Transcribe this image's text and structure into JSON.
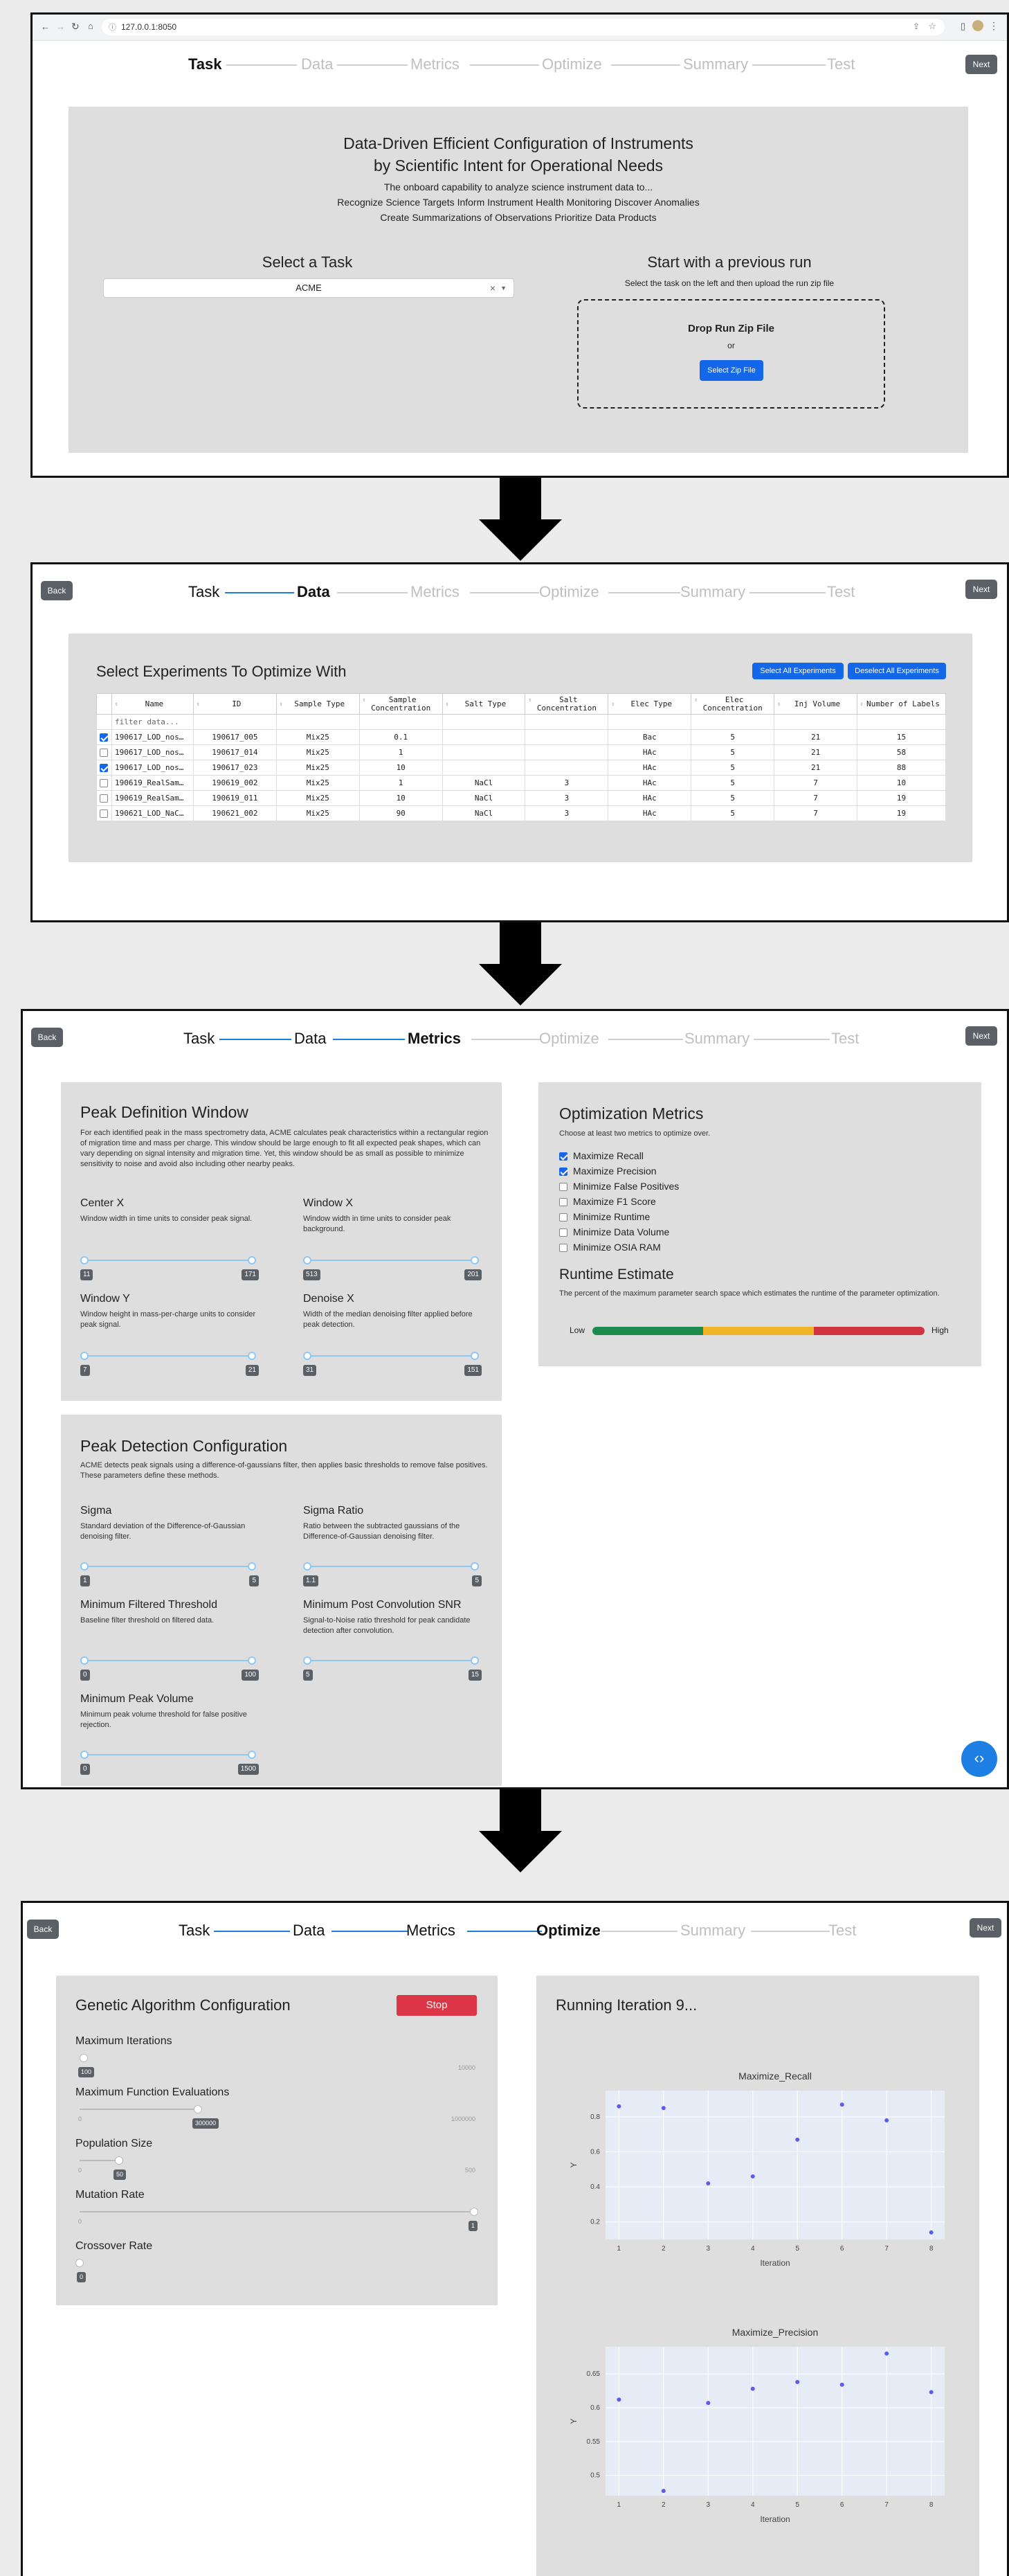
{
  "browser": {
    "url": "127.0.0.1:8050"
  },
  "steps": [
    "Task",
    "Data",
    "Metrics",
    "Optimize",
    "Summary",
    "Test"
  ],
  "buttons": {
    "next": "Next",
    "back": "Back"
  },
  "task_page": {
    "heading_line1": "Data-Driven Efficient Configuration of Instruments",
    "heading_line2": "by Scientific Intent for Operational Needs",
    "sub1": "The onboard capability to analyze science instrument data to...",
    "sub2": "Recognize Science Targets Inform Instrument Health Monitoring Discover Anomalies",
    "sub3": "Create Summarizations of Observations Prioritize Data Products",
    "select_title": "Select a Task",
    "select_value": "ACME",
    "select_clear": "×",
    "prev_title": "Start with a previous run",
    "prev_sub": "Select the task on the left and then upload the run zip file",
    "drop_title": "Drop Run Zip File",
    "drop_or": "or",
    "drop_button": "Select Zip File"
  },
  "data_page": {
    "title": "Select Experiments To Optimize With",
    "select_all": "Select All Experiments",
    "deselect_all": "Deselect All Experiments",
    "filter_placeholder": "filter data...",
    "columns": [
      "Name",
      "ID",
      "Sample Type",
      "Sample Concentration",
      "Salt Type",
      "Salt Concentration",
      "Elec Type",
      "Elec Concentration",
      "Inj Volume",
      "Number of Labels"
    ],
    "rows": [
      {
        "checked": true,
        "cells": [
          "190617_LOD_nos…",
          "190617_005",
          "Mix25",
          "0.1",
          "",
          "",
          "Bac",
          "5",
          "21",
          "15"
        ]
      },
      {
        "checked": false,
        "cells": [
          "190617_LOD_nos…",
          "190617_014",
          "Mix25",
          "1",
          "",
          "",
          "HAc",
          "5",
          "21",
          "58"
        ]
      },
      {
        "checked": true,
        "cells": [
          "190617_LOD_nos…",
          "190617_023",
          "Mix25",
          "10",
          "",
          "",
          "HAc",
          "5",
          "21",
          "88"
        ]
      },
      {
        "checked": false,
        "cells": [
          "190619_RealSam…",
          "190619_002",
          "Mix25",
          "1",
          "NaCl",
          "3",
          "HAc",
          "5",
          "7",
          "10"
        ]
      },
      {
        "checked": false,
        "cells": [
          "190619_RealSam…",
          "190619_011",
          "Mix25",
          "10",
          "NaCl",
          "3",
          "HAc",
          "5",
          "7",
          "19"
        ]
      },
      {
        "checked": false,
        "cells": [
          "190621_LOD_NaC…",
          "190621_002",
          "Mix25",
          "90",
          "NaCl",
          "3",
          "HAc",
          "5",
          "7",
          "19"
        ]
      }
    ]
  },
  "metrics_page": {
    "peak_def": {
      "title": "Peak Definition Window",
      "desc": "For each identified peak in the mass spectrometry data, ACME calculates peak characteristics within a rectangular region of migration time and mass per charge. This window should be large enough to fit all expected peak shapes, which can vary depending on signal intensity and migration time. Yet, this window should be as small as possible to minimize sensitivity to noise and avoid also including other nearby peaks.",
      "params": [
        {
          "name": "Center X",
          "desc": "Window width in time units to consider peak signal.",
          "min": "11",
          "max": "171"
        },
        {
          "name": "Window X",
          "desc": "Window width in time units to consider peak background.",
          "min": "513",
          "max": "201"
        },
        {
          "name": "Window Y",
          "desc": "Window height in mass-per-charge units to consider peak signal.",
          "min": "7",
          "max": "21"
        },
        {
          "name": "Denoise X",
          "desc": "Width of the median denoising filter applied before peak detection.",
          "min": "31",
          "max": "151"
        }
      ]
    },
    "peak_det": {
      "title": "Peak Detection Configuration",
      "desc": "ACME detects peak signals using a difference-of-gaussians filter, then applies basic thresholds to remove false positives. These parameters define these methods.",
      "params": [
        {
          "name": "Sigma",
          "desc": "Standard deviation of the Difference-of-Gaussian denoising filter.",
          "min": "1",
          "max": "5"
        },
        {
          "name": "Sigma Ratio",
          "desc": "Ratio between the subtracted gaussians of the Difference-of-Gaussian denoising filter.",
          "min": "1.1",
          "max": "5"
        },
        {
          "name": "Minimum Filtered Threshold",
          "desc": "Baseline filter threshold on filtered data.",
          "min": "0",
          "max": "100"
        },
        {
          "name": "Minimum Post Convolution SNR",
          "desc": "Signal-to-Noise ratio threshold for peak candidate detection after convolution.",
          "min": "5",
          "max": "15"
        },
        {
          "name": "Minimum Peak Volume",
          "desc": "Minimum peak volume threshold for false positive rejection.",
          "min": "0",
          "max": "1500"
        }
      ]
    },
    "opt_metrics": {
      "title": "Optimization Metrics",
      "desc": "Choose at least two metrics to optimize over.",
      "items": [
        {
          "label": "Maximize Recall",
          "checked": true
        },
        {
          "label": "Maximize Precision",
          "checked": true
        },
        {
          "label": "Minimize False Positives",
          "checked": false
        },
        {
          "label": "Maximize F1 Score",
          "checked": false
        },
        {
          "label": "Minimize Runtime",
          "checked": false
        },
        {
          "label": "Minimize Data Volume",
          "checked": false
        },
        {
          "label": "Minimize OSIA RAM",
          "checked": false
        }
      ],
      "runtime_title": "Runtime Estimate",
      "runtime_desc": "The percent of the maximum parameter search space which estimates the runtime of the parameter optimization.",
      "low": "Low",
      "high": "High"
    },
    "chevrons": "‹›"
  },
  "optimize_page": {
    "ga_title": "Genetic Algorithm Configuration",
    "stop": "Stop",
    "params": [
      {
        "name": "Maximum Iterations",
        "min": "",
        "max": "10000",
        "value": "100",
        "fraction": 0.01
      },
      {
        "name": "Maximum Function Evaluations",
        "min": "0",
        "max": "1000000",
        "value": "300000",
        "fraction": 0.3
      },
      {
        "name": "Population Size",
        "min": "0",
        "max": "500",
        "value": "50",
        "fraction": 0.1
      },
      {
        "name": "Mutation Rate",
        "min": "0",
        "max": "",
        "value": "1",
        "fraction": 1.0
      },
      {
        "name": "Crossover Rate",
        "min": "",
        "max": "",
        "value": "0",
        "fraction": 0.0
      }
    ],
    "running": "Running Iteration 9..."
  },
  "colors": {
    "accent": "#1d7fe3",
    "stop": "#dc3545",
    "point": "#5b5bf0",
    "runtime_green": "#1d8a4e",
    "runtime_yellow": "#f0b429",
    "runtime_red": "#d1343f"
  },
  "chart_data": [
    {
      "type": "scatter",
      "title": "Maximize_Recall",
      "xlabel": "Iteration",
      "ylabel": "Y",
      "x": [
        1,
        2,
        3,
        4,
        5,
        6,
        7,
        8
      ],
      "y": [
        0.86,
        0.85,
        0.42,
        0.46,
        0.67,
        0.87,
        0.78,
        0.14
      ],
      "xlim": [
        0.7,
        8.3
      ],
      "ylim": [
        0.1,
        0.95
      ],
      "xticks": [
        "1",
        "2",
        "3",
        "4",
        "5",
        "6",
        "7",
        "8"
      ],
      "yticks": [
        "0.2",
        "0.4",
        "0.6",
        "0.8"
      ],
      "ytick_values": [
        0.2,
        0.4,
        0.6,
        0.8
      ]
    },
    {
      "type": "scatter",
      "title": "Maximize_Precision",
      "xlabel": "Iteration",
      "ylabel": "Y",
      "x": [
        1,
        2,
        3,
        4,
        5,
        6,
        7,
        8
      ],
      "y": [
        0.612,
        0.477,
        0.607,
        0.628,
        0.638,
        0.634,
        0.68,
        0.623
      ],
      "xlim": [
        0.7,
        8.3
      ],
      "ylim": [
        0.47,
        0.69
      ],
      "xticks": [
        "1",
        "2",
        "3",
        "4",
        "5",
        "6",
        "7",
        "8"
      ],
      "yticks": [
        "0.5",
        "0.55",
        "0.6",
        "0.65"
      ],
      "ytick_values": [
        0.5,
        0.55,
        0.6,
        0.65
      ]
    }
  ]
}
